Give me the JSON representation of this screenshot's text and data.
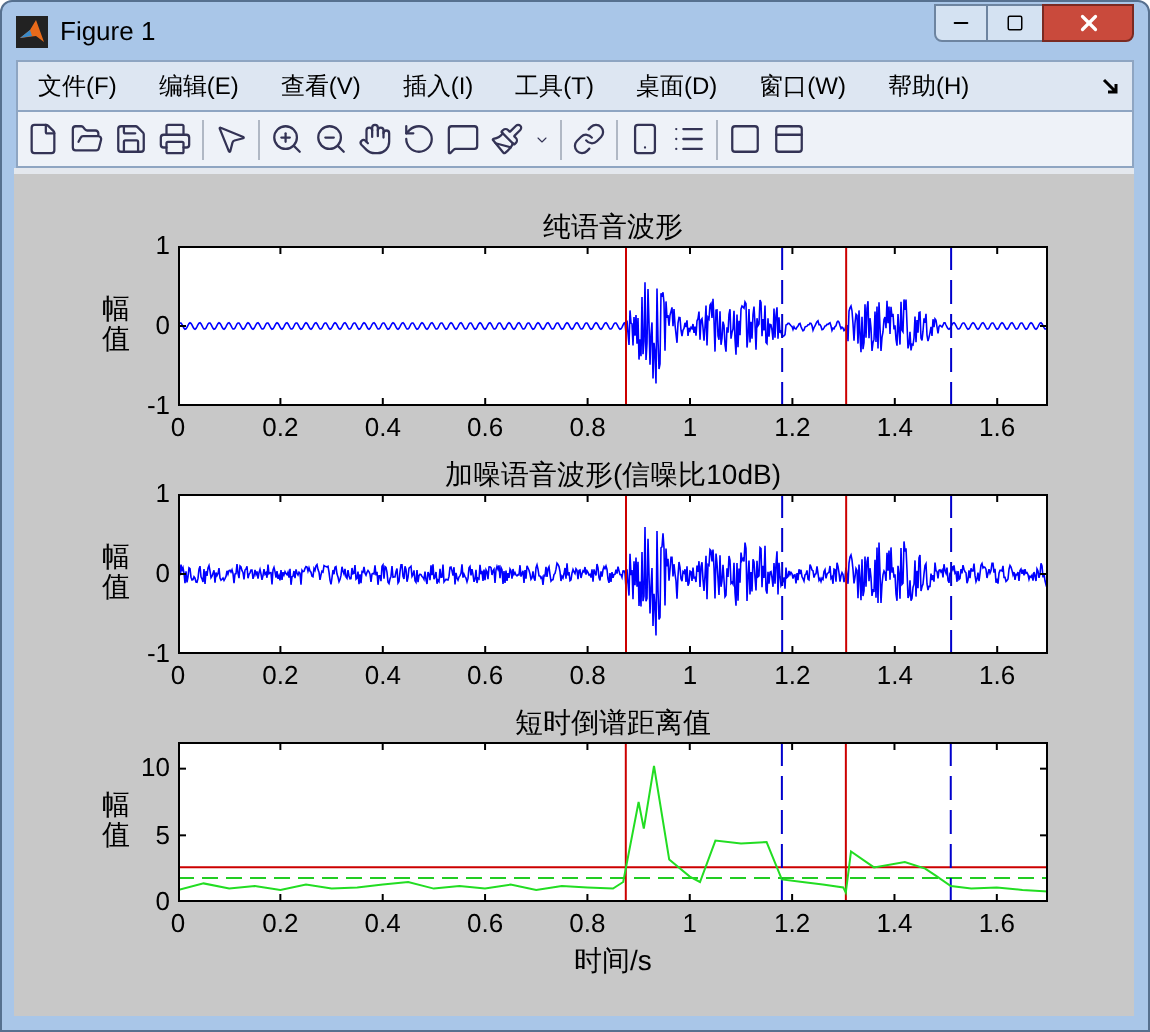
{
  "window": {
    "title": "Figure 1"
  },
  "menu": [
    "文件(F)",
    "编辑(E)",
    "查看(V)",
    "插入(I)",
    "工具(T)",
    "桌面(D)",
    "窗口(W)",
    "帮助(H)"
  ],
  "plots": [
    {
      "kind": "clean",
      "title": "纯语音波形",
      "ylabel": "幅值",
      "yticks": [
        "1",
        "0",
        "-1"
      ],
      "xticks": [
        "0",
        "0.2",
        "0.4",
        "0.6",
        "0.8",
        "1",
        "1.2",
        "1.4",
        "1.6"
      ]
    },
    {
      "kind": "noisy",
      "title": "加噪语音波形(信噪比10dB)",
      "ylabel": "幅值",
      "yticks": [
        "1",
        "0",
        "-1"
      ],
      "xticks": [
        "0",
        "0.2",
        "0.4",
        "0.6",
        "0.8",
        "1",
        "1.2",
        "1.4",
        "1.6"
      ]
    },
    {
      "kind": "distance",
      "chart_data": {
        "type": "line",
        "title": "短时倒谱距离值",
        "xlabel": "时间/s",
        "ylabel": "幅值",
        "xlim": [
          0,
          1.7
        ],
        "ylim": [
          0,
          12
        ],
        "xticks": [
          0,
          0.2,
          0.4,
          0.6,
          0.8,
          1,
          1.2,
          1.4,
          1.6
        ],
        "yticks": [
          0,
          5,
          10
        ],
        "x": [
          0,
          0.05,
          0.1,
          0.15,
          0.2,
          0.25,
          0.3,
          0.35,
          0.4,
          0.45,
          0.5,
          0.55,
          0.6,
          0.65,
          0.7,
          0.75,
          0.8,
          0.85,
          0.87,
          0.9,
          0.91,
          0.93,
          0.96,
          1.0,
          1.02,
          1.05,
          1.1,
          1.15,
          1.18,
          1.22,
          1.26,
          1.3,
          1.305,
          1.315,
          1.36,
          1.42,
          1.46,
          1.48,
          1.51,
          1.55,
          1.6,
          1.65,
          1.7
        ],
        "series": [
          {
            "color": "#22dd22",
            "values": [
              0.9,
              1.4,
              1.0,
              1.2,
              0.9,
              1.3,
              1.0,
              1.1,
              1.3,
              1.5,
              1.0,
              1.2,
              1.0,
              1.3,
              0.9,
              1.2,
              1.1,
              1.0,
              1.5,
              7.5,
              5.5,
              10.2,
              3.2,
              1.9,
              1.5,
              4.6,
              4.4,
              4.5,
              1.7,
              1.5,
              1.3,
              1.1,
              0.7,
              3.8,
              2.6,
              3.0,
              2.5,
              2.0,
              1.2,
              1.0,
              1.1,
              0.9,
              0.8
            ]
          }
        ],
        "ref_lines": [
          {
            "axis": "y",
            "value": 2.6,
            "color": "#cc0000"
          },
          {
            "axis": "y",
            "value": 1.8,
            "color": "#22cc22"
          },
          {
            "axis": "x",
            "value": 0.875,
            "color": "#cc0000"
          },
          {
            "axis": "x",
            "value": 1.18,
            "color": "#0000cc"
          },
          {
            "axis": "x",
            "value": 1.305,
            "color": "#cc0000"
          },
          {
            "axis": "x",
            "value": 1.51,
            "color": "#0000cc"
          }
        ]
      }
    }
  ]
}
